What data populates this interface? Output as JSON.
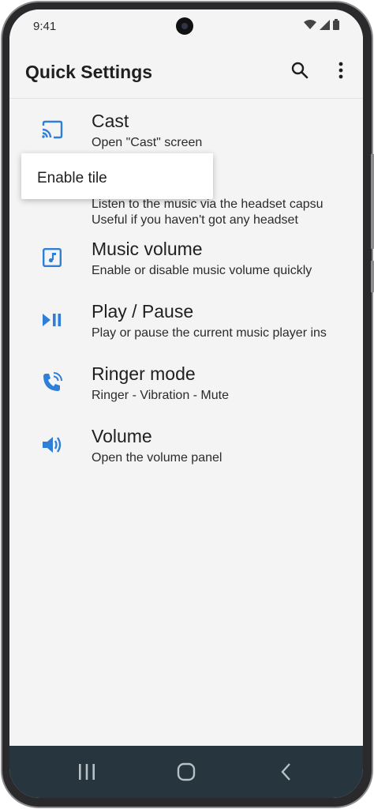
{
  "status_bar": {
    "time": "9:41"
  },
  "app_bar": {
    "title": "Quick Settings",
    "search_icon": "search-icon",
    "more_icon": "more-vert-icon"
  },
  "popup": {
    "label": "Enable tile"
  },
  "tiles": [
    {
      "icon": "cast-icon",
      "title": "Cast",
      "subtitle": "Open \"Cast\" screen"
    },
    {
      "icon": "headset-icon",
      "subtitle_line1": "Listen to the music via the headset capsu",
      "subtitle_line2": "Useful if you haven't got any headset"
    },
    {
      "icon": "music-note-icon",
      "title": "Music volume",
      "subtitle": "Enable or disable music volume quickly"
    },
    {
      "icon": "play-pause-icon",
      "title": "Play / Pause",
      "subtitle": "Play or pause the current music player ins"
    },
    {
      "icon": "phone-ring-icon",
      "title": "Ringer mode",
      "subtitle": "Ringer - Vibration - Mute"
    },
    {
      "icon": "speaker-icon",
      "title": "Volume",
      "subtitle": "Open the volume panel"
    }
  ],
  "colors": {
    "accent": "#2f7fd8",
    "nav_bar": "#26353e",
    "background": "#f4f4f4"
  }
}
